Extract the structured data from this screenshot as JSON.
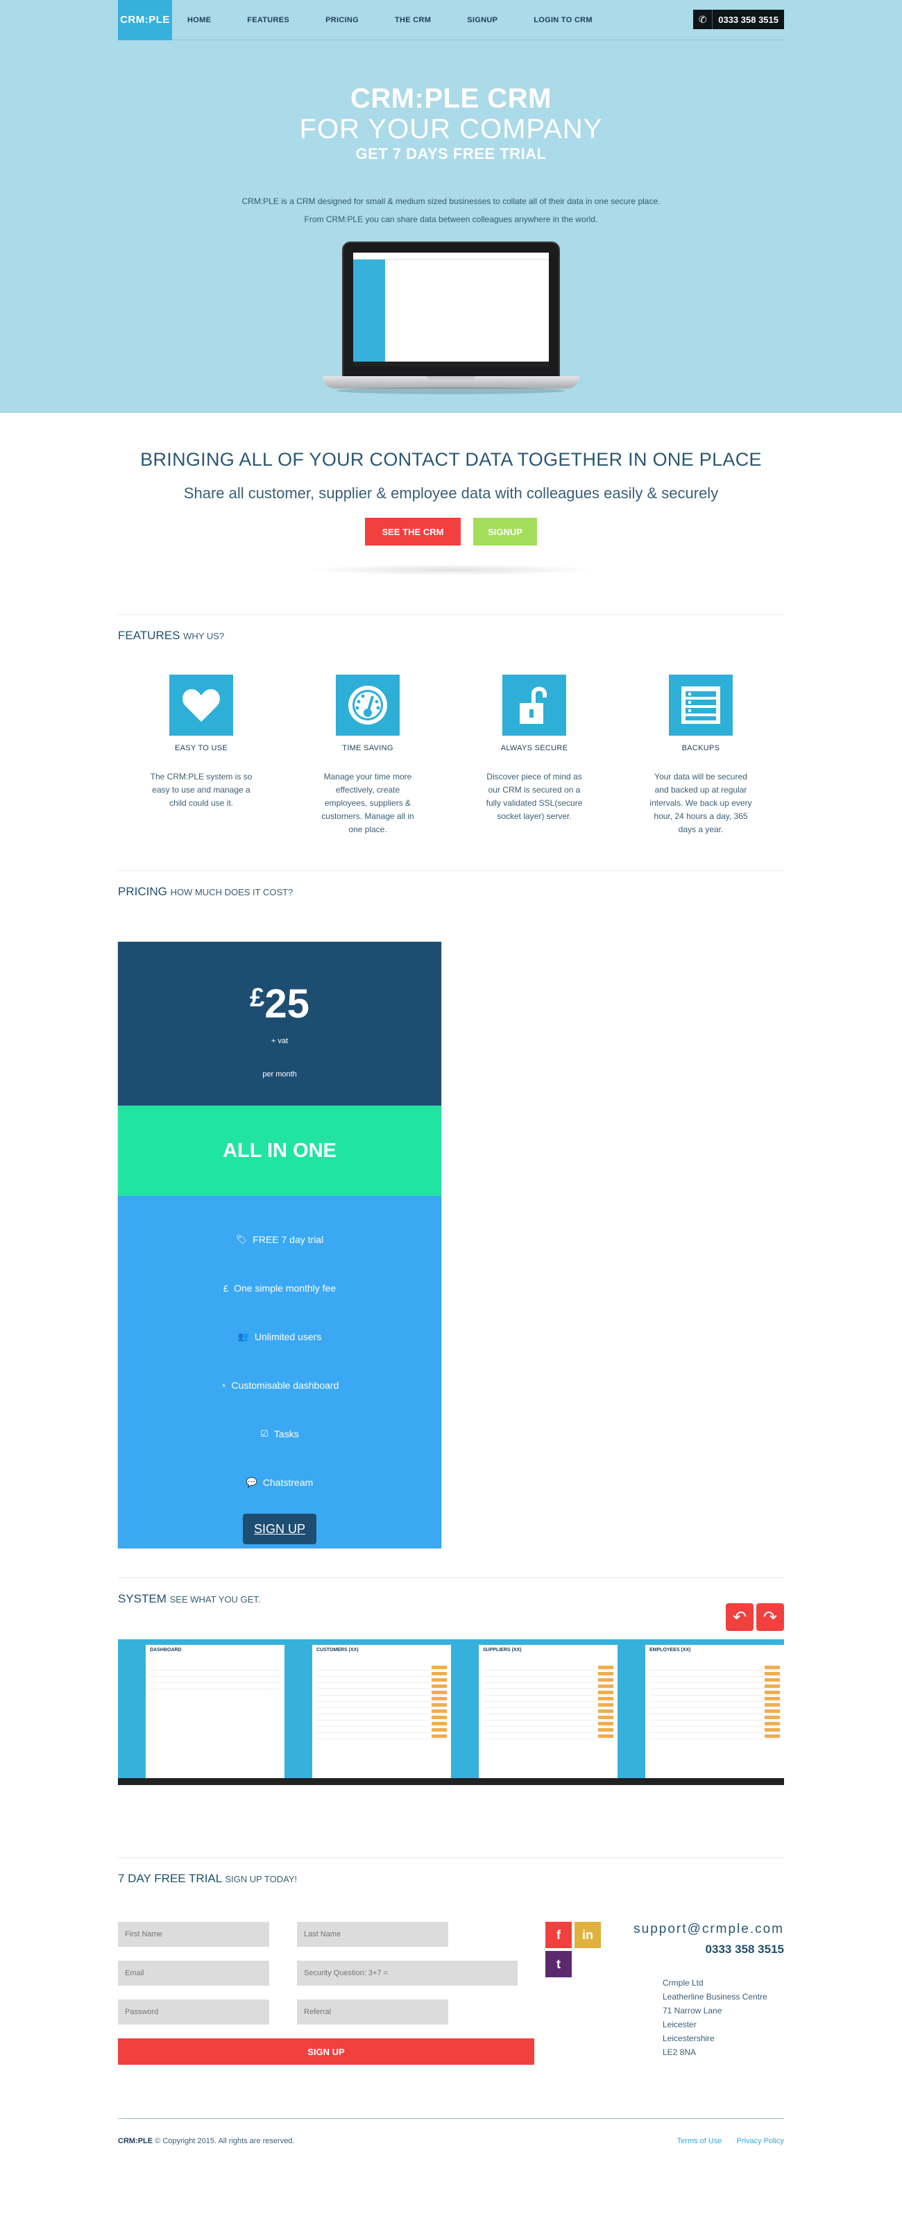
{
  "nav": {
    "brand": "CRM:PLE",
    "items": [
      "HOME",
      "FEATURES",
      "PRICING",
      "THE CRM",
      "SIGNUP",
      "LOGIN TO CRM"
    ],
    "phone": "0333 358 3515",
    "phone_icon": "phone-icon"
  },
  "hero": {
    "line1": "CRM:PLE CRM",
    "line2": "FOR YOUR COMPANY",
    "line3": "GET 7 DAYS FREE TRIAL",
    "desc1": "CRM:PLE is a CRM designed for small & medium sized businesses to collate all of their data in one secure place.",
    "desc2": "From CRM:PLE you can share data between colleagues anywhere in the world."
  },
  "intro": {
    "heading": "BRINGING ALL OF YOUR CONTACT DATA TOGETHER IN ONE PLACE",
    "subheading": "Share all customer, supplier & employee data with colleagues easily & securely",
    "btn_crm": "SEE THE CRM",
    "btn_signup": "SIGNUP"
  },
  "features": {
    "title": "FEATURES",
    "subtitle": "WHY US?",
    "items": [
      {
        "icon": "heart-icon",
        "title": "EASY TO USE",
        "desc": "The CRM:PLE system is so easy to use and manage a child could use it."
      },
      {
        "icon": "gauge-icon",
        "title": "TIME SAVING",
        "desc": "Manage your time more effectively, create employees, suppliers & customers. Manage all in one place."
      },
      {
        "icon": "unlock-icon",
        "title": "ALWAYS SECURE",
        "desc": "Discover piece of mind as our CRM is secured on a fully validated SSL(secure socket layer) server."
      },
      {
        "icon": "server-icon",
        "title": "BACKUPS",
        "desc": "Your data will be secured and backed up at regular intervals. We back up every hour, 24 hours a day, 365 days a year."
      }
    ]
  },
  "pricing": {
    "title": "PRICING",
    "subtitle": "HOW MUCH DOES IT COST?",
    "currency": "£",
    "amount": "25",
    "vat": "+ vat",
    "period": "per month",
    "plan": "ALL IN ONE",
    "items": [
      {
        "icon": "tag-icon",
        "label": "FREE 7 day trial"
      },
      {
        "icon": "pound-icon",
        "label": "One simple monthly fee"
      },
      {
        "icon": "users-icon",
        "label": "Unlimited users"
      },
      {
        "icon": "dashboard-icon",
        "label": "Customisable dashboard"
      },
      {
        "icon": "checkbox-icon",
        "label": "Tasks"
      },
      {
        "icon": "chat-icon",
        "label": "Chatstream"
      }
    ],
    "button": "SIGN UP"
  },
  "system": {
    "title": "SYSTEM",
    "subtitle": "SEE WHAT YOU GET.",
    "shots": [
      "DASHBOARD",
      "CUSTOMERS (XX)",
      "SUPPLIERS (XX)",
      "EMPLOYEES (XX)"
    ],
    "prev_icon": "reply-arrow-icon",
    "next_icon": "forward-arrow-icon"
  },
  "signup": {
    "title": "7 DAY FREE TRIAL",
    "subtitle": "SIGN UP TODAY!",
    "fields": {
      "first_name": "First Name",
      "last_name": "Last Name",
      "email": "Email",
      "security": "Security Question: 3+7 =",
      "password": "Password",
      "referral": "Referral"
    },
    "button": "SIGN UP",
    "social": [
      {
        "icon": "facebook-icon",
        "glyph": "f",
        "color": "#f2403e"
      },
      {
        "icon": "linkedin-icon",
        "glyph": "in",
        "color": "#e0b13c"
      },
      {
        "icon": "twitter-icon",
        "glyph": "t",
        "color": "#5b2a6e"
      }
    ],
    "email": "support@crmple.com",
    "phone": "0333 358 3515",
    "address": [
      "Crmple Ltd",
      "Leatherline Business Centre",
      "71 Narrow Lane",
      "Leicester",
      "Leicestershire",
      "LE2 8NA"
    ]
  },
  "footer": {
    "brand": "CRM:PLE",
    "copyright": "© Copyright 2015. All rights are reserved.",
    "links": [
      "Terms of Use",
      "Privacy Policy"
    ]
  }
}
